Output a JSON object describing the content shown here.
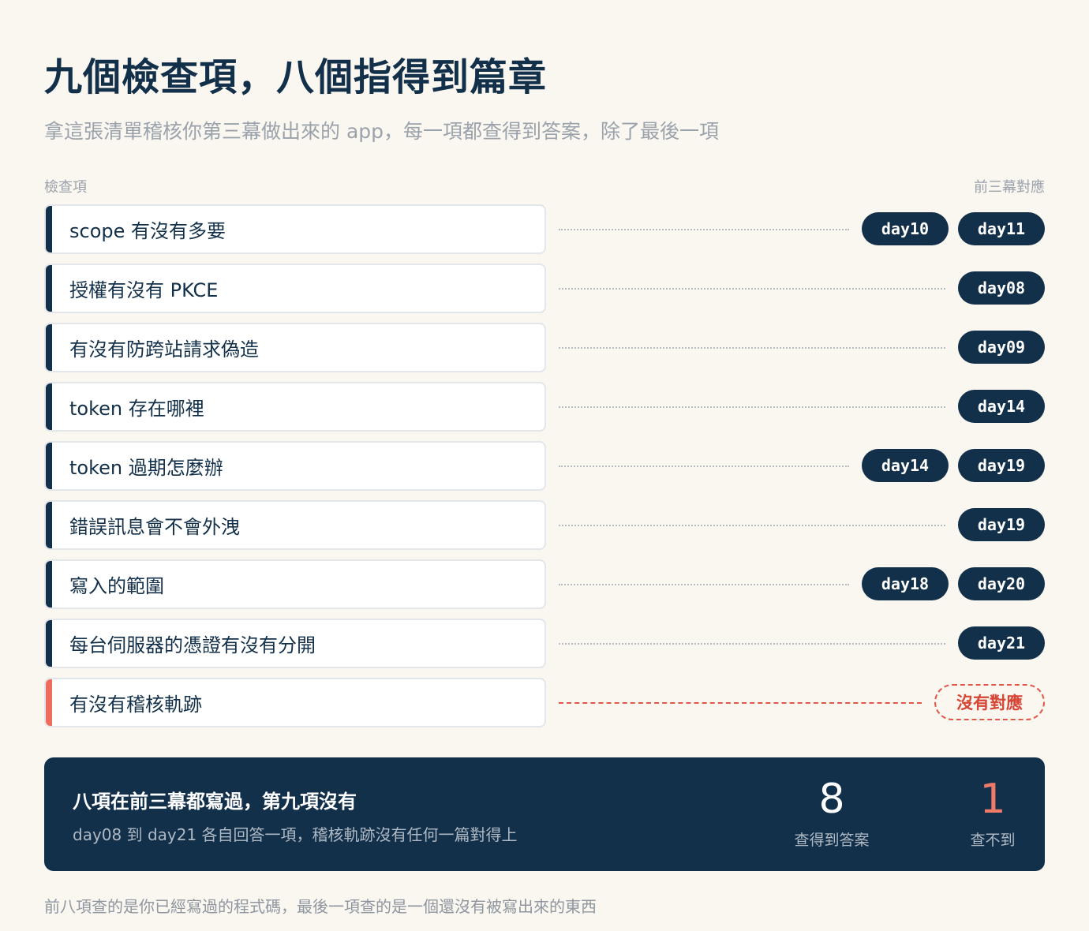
{
  "header": {
    "title": "九個檢查項，八個指得到篇章",
    "subtitle": "拿這張清單稽核你第三幕做出來的 app，每一項都查得到答案，除了最後一項"
  },
  "columns": {
    "left": "檢查項",
    "right": "前三幕對應"
  },
  "items": [
    {
      "label": "scope 有沒有多要",
      "days": [
        "day10",
        "day11"
      ]
    },
    {
      "label": "授權有沒有 PKCE",
      "days": [
        "day08"
      ]
    },
    {
      "label": "有沒有防跨站請求偽造",
      "days": [
        "day09"
      ]
    },
    {
      "label": "token 存在哪裡",
      "days": [
        "day14"
      ]
    },
    {
      "label": "token 過期怎麼辦",
      "days": [
        "day14",
        "day19"
      ]
    },
    {
      "label": "錯誤訊息會不會外洩",
      "days": [
        "day19"
      ]
    },
    {
      "label": "寫入的範圍",
      "days": [
        "day18",
        "day20"
      ]
    },
    {
      "label": "每台伺服器的憑證有沒有分開",
      "days": [
        "day21"
      ]
    },
    {
      "label": "有沒有稽核軌跡",
      "days": [],
      "missing_label": "沒有對應"
    }
  ],
  "summary": {
    "heading": "八項在前三幕都寫過，第九項沒有",
    "description": "day08 到 day21 各自回答一項，稽核軌跡沒有任何一篇對得上",
    "found_count": "8",
    "found_label": "查得到答案",
    "missing_count": "1",
    "missing_label": "查不到"
  },
  "footer": "前八項查的是你已經寫過的程式碼，最後一項查的是一個還沒有被寫出來的東西",
  "colors": {
    "navy": "#13304a",
    "accent_red": "#ef6b5c",
    "background": "#faf6f0"
  }
}
